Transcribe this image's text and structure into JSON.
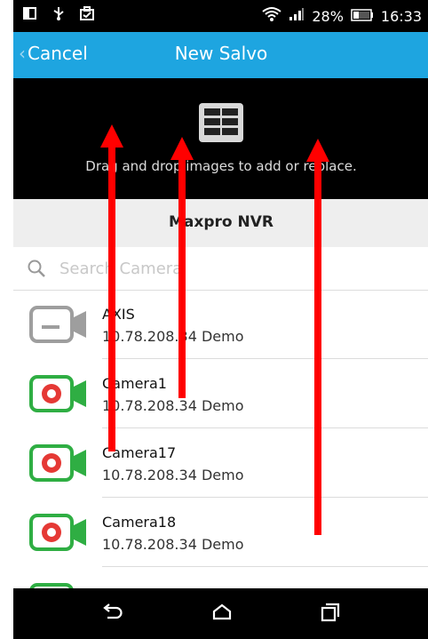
{
  "status_bar": {
    "battery": "28%",
    "time": "16:33"
  },
  "app_bar": {
    "cancel_label": "Cancel",
    "title": "New Salvo"
  },
  "drop_zone": {
    "instruction": "Drag and drop images to add or replace."
  },
  "nvr": {
    "title": "Maxpro NVR"
  },
  "search": {
    "placeholder": "Search Camera"
  },
  "cameras": [
    {
      "name": "AXIS",
      "detail": "10.78.208.34 Demo",
      "status": "offline",
      "color": "#9e9e9e"
    },
    {
      "name": "Camera1",
      "detail": "10.78.208.34 Demo",
      "status": "recording",
      "color": "#2fae43"
    },
    {
      "name": "Camera17",
      "detail": "10.78.208.34 Demo",
      "status": "recording",
      "color": "#2fae43"
    },
    {
      "name": "Camera18",
      "detail": "10.78.208.34 Demo",
      "status": "recording",
      "color": "#2fae43"
    }
  ],
  "colors": {
    "app_bar": "#1ea5e0",
    "recording": "#2fae43",
    "recording_dot": "#e53935",
    "offline": "#9e9e9e",
    "annotation_arrow": "#ff0000"
  },
  "icons": {
    "status_left": [
      "notification-icon",
      "usb-icon",
      "briefcase-icon"
    ],
    "status_right": [
      "wifi-icon",
      "signal-icon",
      "battery-icon"
    ],
    "drop_zone": "grid-layout-icon",
    "search": "search-icon",
    "nav": [
      "back-icon",
      "home-icon",
      "recents-icon"
    ]
  }
}
